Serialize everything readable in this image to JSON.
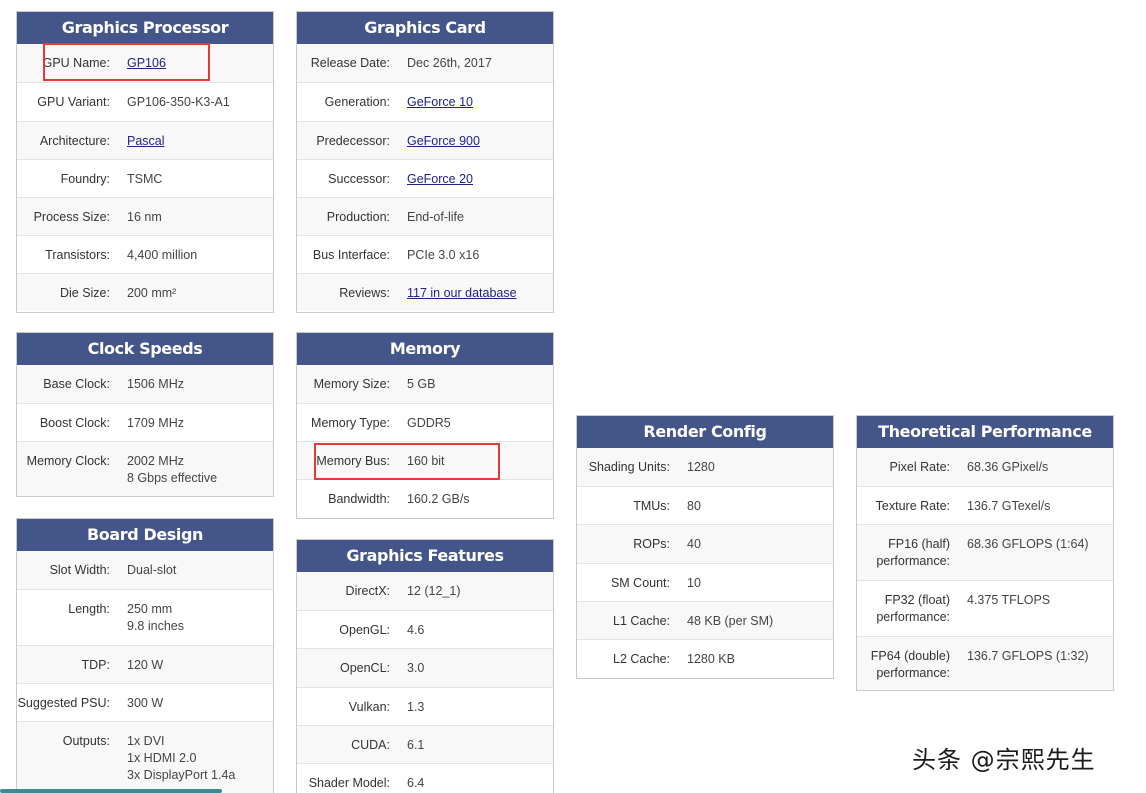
{
  "cards": {
    "graphics_processor": {
      "title": "Graphics Processor",
      "rows": [
        {
          "label": "GPU Name:",
          "value": "GP106"
        },
        {
          "label": "GPU Variant:",
          "value": "GP106-350-K3-A1"
        },
        {
          "label": "Architecture:",
          "value": "Pascal"
        },
        {
          "label": "Foundry:",
          "value": "TSMC"
        },
        {
          "label": "Process Size:",
          "value": "16 nm"
        },
        {
          "label": "Transistors:",
          "value": "4,400 million"
        },
        {
          "label": "Die Size:",
          "value": "200 mm²"
        }
      ]
    },
    "graphics_card": {
      "title": "Graphics Card",
      "rows": [
        {
          "label": "Release Date:",
          "value": "Dec 26th, 2017"
        },
        {
          "label": "Generation:",
          "value": "GeForce 10"
        },
        {
          "label": "Predecessor:",
          "value": "GeForce 900"
        },
        {
          "label": "Successor:",
          "value": "GeForce 20"
        },
        {
          "label": "Production:",
          "value": "End-of-life"
        },
        {
          "label": "Bus Interface:",
          "value": "PCIe 3.0 x16"
        },
        {
          "label": "Reviews:",
          "value": "117 in our database"
        }
      ]
    },
    "clock_speeds": {
      "title": "Clock Speeds",
      "rows": [
        {
          "label": "Base Clock:",
          "value": "1506 MHz"
        },
        {
          "label": "Boost Clock:",
          "value": "1709 MHz"
        },
        {
          "label": "Memory Clock:",
          "value": "2002 MHz",
          "value2": "8 Gbps effective"
        }
      ]
    },
    "memory": {
      "title": "Memory",
      "rows": [
        {
          "label": "Memory Size:",
          "value": "5 GB"
        },
        {
          "label": "Memory Type:",
          "value": "GDDR5"
        },
        {
          "label": "Memory Bus:",
          "value": "160 bit"
        },
        {
          "label": "Bandwidth:",
          "value": "160.2 GB/s"
        }
      ]
    },
    "board_design": {
      "title": "Board Design",
      "rows": [
        {
          "label": "Slot Width:",
          "value": "Dual-slot"
        },
        {
          "label": "Length:",
          "value": "250 mm",
          "value2": "9.8 inches"
        },
        {
          "label": "TDP:",
          "value": "120 W"
        },
        {
          "label": "Suggested PSU:",
          "value": "300 W"
        },
        {
          "label": "Outputs:",
          "value": "1x DVI",
          "value2": "1x HDMI 2.0",
          "value3": "3x DisplayPort 1.4a"
        }
      ]
    },
    "graphics_features": {
      "title": "Graphics Features",
      "rows": [
        {
          "label": "DirectX:",
          "value": "12 (12_1)"
        },
        {
          "label": "OpenGL:",
          "value": "4.6"
        },
        {
          "label": "OpenCL:",
          "value": "3.0"
        },
        {
          "label": "Vulkan:",
          "value": "1.3"
        },
        {
          "label": "CUDA:",
          "value": "6.1"
        },
        {
          "label": "Shader Model:",
          "value": "6.4"
        }
      ]
    },
    "render_config": {
      "title": "Render Config",
      "rows": [
        {
          "label": "Shading Units:",
          "value": "1280"
        },
        {
          "label": "TMUs:",
          "value": "80"
        },
        {
          "label": "ROPs:",
          "value": "40"
        },
        {
          "label": "SM Count:",
          "value": "10"
        },
        {
          "label": "L1 Cache:",
          "value": "48 KB (per SM)"
        },
        {
          "label": "L2 Cache:",
          "value": "1280 KB"
        }
      ]
    },
    "theoretical_performance": {
      "title": "Theoretical Performance",
      "rows": [
        {
          "label": "Pixel Rate:",
          "value": "68.36 GPixel/s"
        },
        {
          "label": "Texture Rate:",
          "value": "136.7 GTexel/s"
        },
        {
          "label": "FP16 (half)",
          "label2": "performance:",
          "value": "68.36 GFLOPS (1:64)"
        },
        {
          "label": "FP32 (float)",
          "label2": "performance:",
          "value": "4.375 TFLOPS"
        },
        {
          "label": "FP64 (double)",
          "label2": "performance:",
          "value": "136.7 GFLOPS (1:32)"
        }
      ]
    }
  },
  "watermark": "头条 @宗熙先生",
  "colors": {
    "header_bg": "#44558a",
    "link": "#222288",
    "highlight": "#e53935"
  }
}
